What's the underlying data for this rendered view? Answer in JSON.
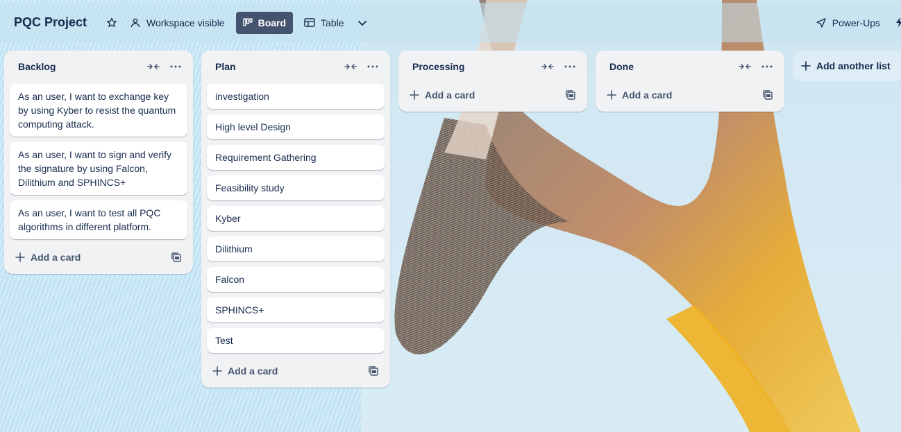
{
  "header": {
    "board_title": "PQC Project",
    "visibility_label": "Workspace visible",
    "views": [
      {
        "label": "Board",
        "icon": "board-icon",
        "active": true
      },
      {
        "label": "Table",
        "icon": "table-icon",
        "active": false
      }
    ],
    "power_ups_label": "Power-Ups"
  },
  "lists": [
    {
      "title": "Backlog",
      "cards": [
        "As an user, I want to exchange key by using Kyber to resist the quantum computing attack.",
        "As an user, I want to sign and verify the signature by using Falcon, Dilithium and SPHINCS+",
        "As an user, I want to test all PQC algorithms in different platform."
      ],
      "add_card_label": "Add a card"
    },
    {
      "title": "Plan",
      "cards": [
        "investigation",
        "High level Design",
        "Requirement Gathering",
        "Feasibility study",
        "Kyber",
        "Dilithium",
        "Falcon",
        "SPHINCS+",
        "Test"
      ],
      "add_card_label": "Add a card"
    },
    {
      "title": "Processing",
      "cards": [],
      "add_card_label": "Add a card"
    },
    {
      "title": "Done",
      "cards": [],
      "add_card_label": "Add a card"
    }
  ],
  "add_list_label": "Add another list",
  "colors": {
    "text": "#172b4d",
    "list_bg": "#f1f2f4",
    "active_view_bg": "#44546f",
    "muted": "#44546f"
  }
}
